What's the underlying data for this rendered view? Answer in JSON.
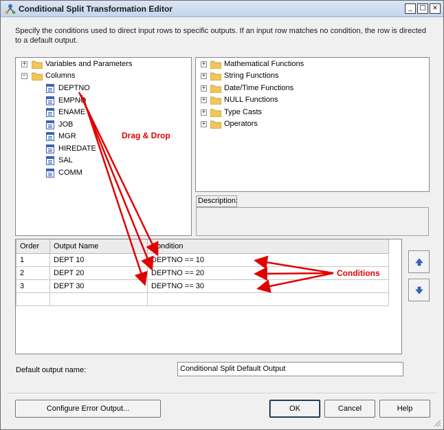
{
  "window": {
    "title": "Conditional Split Transformation Editor",
    "minimize": "_",
    "maximize": "□",
    "close": "×"
  },
  "instructions": "Specify the conditions used to direct input rows to specific outputs. If an input row matches no condition, the row is directed to a default output.",
  "left_tree": {
    "nodes": [
      {
        "label": "Variables and Parameters",
        "expander": "+"
      },
      {
        "label": "Columns",
        "expander": "−"
      }
    ],
    "columns": [
      "DEPTNO",
      "EMPNO",
      "ENAME",
      "JOB",
      "MGR",
      "HIREDATE",
      "SAL",
      "COMM"
    ]
  },
  "right_tree": {
    "nodes": [
      {
        "label": "Mathematical Functions",
        "expander": "+"
      },
      {
        "label": "String Functions",
        "expander": "+"
      },
      {
        "label": "Date/Time Functions",
        "expander": "+"
      },
      {
        "label": "NULL Functions",
        "expander": "+"
      },
      {
        "label": "Type Casts",
        "expander": "+"
      },
      {
        "label": "Operators",
        "expander": "+"
      }
    ]
  },
  "description": {
    "label": "Description:",
    "text": ""
  },
  "grid": {
    "headers": [
      "Order",
      "Output Name",
      "Condition"
    ],
    "rows": [
      {
        "order": "1",
        "output_name": "DEPT 10",
        "condition": "DEPTNO == 10"
      },
      {
        "order": "2",
        "output_name": "DEPT 20",
        "condition": "DEPTNO == 20"
      },
      {
        "order": "3",
        "output_name": "DEPT 30",
        "condition": "DEPTNO == 30"
      },
      {
        "order": "",
        "output_name": "",
        "condition": ""
      }
    ]
  },
  "move_up_icon": "arrow-up-icon",
  "move_down_icon": "arrow-down-icon",
  "default_output": {
    "label": "Default output name:",
    "value": "Conditional Split Default Output"
  },
  "buttons": {
    "configure_error": "Configure Error Output...",
    "ok": "OK",
    "cancel": "Cancel",
    "help": "Help"
  },
  "annotations": {
    "drag_drop": "Drag & Drop",
    "conditions": "Conditions",
    "color": "#e00000"
  }
}
